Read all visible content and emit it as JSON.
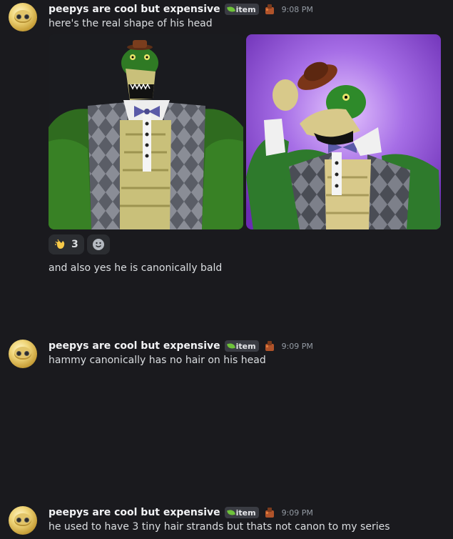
{
  "messages": [
    {
      "author": "peepys are cool but expensive",
      "tag": "item",
      "time": "9:08 PM",
      "text": "here's the real shape of his head",
      "reaction": {
        "emoji": "hand-clap-icon",
        "count": "3"
      },
      "followup": "and also yes he is canonically bald"
    },
    {
      "author": "peepys are cool but expensive",
      "tag": "item",
      "time": "9:09 PM",
      "text": "hammy canonically has no hair on his head"
    },
    {
      "author": "peepys are cool but expensive",
      "tag": "item",
      "time": "9:09 PM",
      "text": "he used to have 3 tiny hair strands but thats not canon to my series"
    }
  ],
  "colors": {
    "background": "#1a1a1e",
    "username": "#f2f3f5",
    "timestamp": "#949ba4",
    "tag_bg": "#3a3c43",
    "leaf": "#6ec23a"
  }
}
